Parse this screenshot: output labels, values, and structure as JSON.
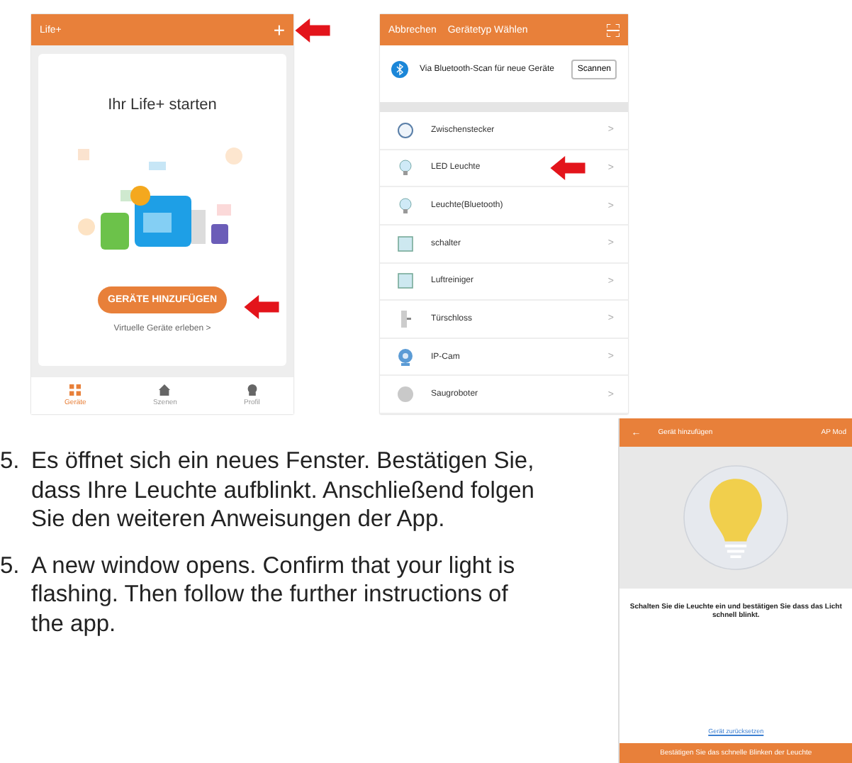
{
  "app_home": {
    "title": "Life+",
    "add_symbol": "+",
    "heading": "Ihr Life+ starten",
    "add_button": "GERÄTE HINZUFÜGEN",
    "virtual_link": "Virtuelle Geräte erleben >",
    "tabs": [
      {
        "label": "Geräte",
        "selected": true
      },
      {
        "label": "Szenen",
        "selected": false
      },
      {
        "label": "Profil",
        "selected": false
      }
    ]
  },
  "device_type_list": {
    "cancel": "Abbrechen",
    "title": "Gerätetyp Wählen",
    "bluetooth_text": "Via Bluetooth-Scan für neue Geräte",
    "scan_button": "Scannen",
    "items": [
      {
        "label": "Zwischenstecker",
        "chevron": ">"
      },
      {
        "label": "LED Leuchte",
        "chevron": ">"
      },
      {
        "label": "Leuchte(Bluetooth)",
        "chevron": ">"
      },
      {
        "label": "schalter",
        "chevron": ">"
      },
      {
        "label": "Luftreiniger",
        "chevron": ">"
      },
      {
        "label": "Türschloss",
        "chevron": ">"
      },
      {
        "label": "IP-Cam",
        "chevron": ">"
      },
      {
        "label": "Saugroboter",
        "chevron": ">"
      }
    ]
  },
  "instructions": [
    {
      "number": "5.",
      "text": "Es öffnet sich ein neues Fenster. Bestätigen Sie, dass Ihre Leuchte aufblinkt. Anschließend folgen Sie den weiteren Anweisungen der App."
    },
    {
      "number": "5.",
      "text": "A new window opens. Confirm that your light is flashing. Then follow the further instructions of the app."
    }
  ],
  "add_device": {
    "back": "←",
    "title": "Gerät hinzufügen",
    "mode": "AP Mod",
    "message": "Schalten Sie die Leuchte ein und bestätigen Sie dass das Licht schnell blinkt.",
    "reset_link": "Gerät zurücksetzen",
    "confirm_button": "Bestätigen Sie das schnelle Blinken der Leuchte"
  }
}
